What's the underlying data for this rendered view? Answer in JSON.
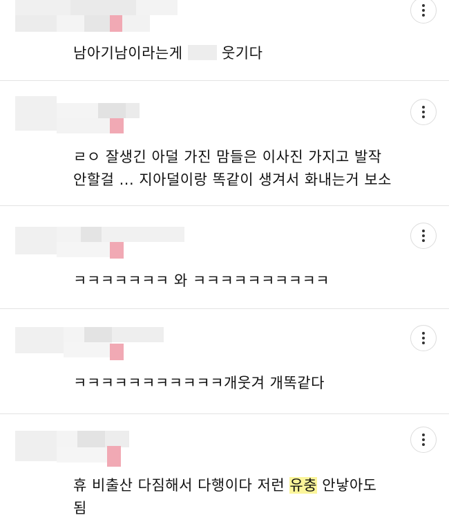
{
  "comments": [
    {
      "author_redacted": true,
      "lines": [
        "남아기남이라는게",
        "웃기다"
      ],
      "has_censor": true
    },
    {
      "author_redacted": true,
      "lines": [
        "ㄹㅇ 잘생긴 아덜 가진 맘들은 이사진 가지고 발작",
        "안할걸 ... 지아덜이랑 똑같이 생겨서 화내는거 보소"
      ]
    },
    {
      "author_redacted": true,
      "lines": [
        "ㅋㅋㅋㅋㅋㅋㅋ 와 ㅋㅋㅋㅋㅋㅋㅋㅋㅋㅋ"
      ]
    },
    {
      "author_redacted": true,
      "lines": [
        "ㅋㅋㅋㅋㅋㅋㅋㅋㅋㅋㅋ개웃겨 개똑같다"
      ]
    },
    {
      "author_redacted": true,
      "lines": [
        "휴 비출산 다짐해서 다행이다 저런",
        "유충",
        "안낳아도",
        "됨"
      ],
      "highlight": "유충"
    }
  ],
  "more_button": {
    "icon": "more-vertical-icon"
  },
  "colors": {
    "highlight": "#fbf59a",
    "divider": "#e3e3e3",
    "text": "#111111"
  }
}
